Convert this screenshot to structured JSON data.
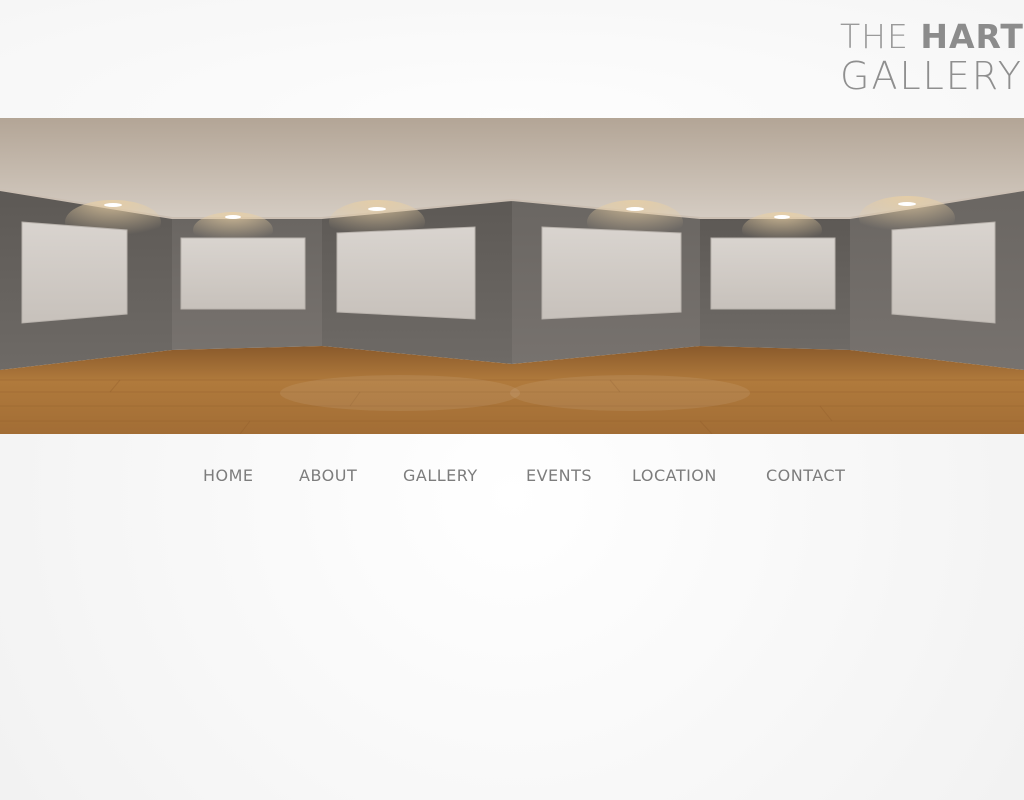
{
  "logo": {
    "word_the": "THE",
    "word_hart": "HART",
    "word_gallery": "GALLERY"
  },
  "hero": {
    "description_icon": "empty-gallery-room-image"
  },
  "nav": {
    "items": [
      {
        "label": "HOME"
      },
      {
        "label": "ABOUT"
      },
      {
        "label": "GALLERY"
      },
      {
        "label": "EVENTS"
      },
      {
        "label": "LOCATION"
      },
      {
        "label": "CONTACT"
      }
    ]
  },
  "colors": {
    "text_gray": "#7d7d7d",
    "wall_gray": "#6f6b68",
    "floor_wood": "#b07a3c",
    "ceiling": "#c8bcb1"
  }
}
